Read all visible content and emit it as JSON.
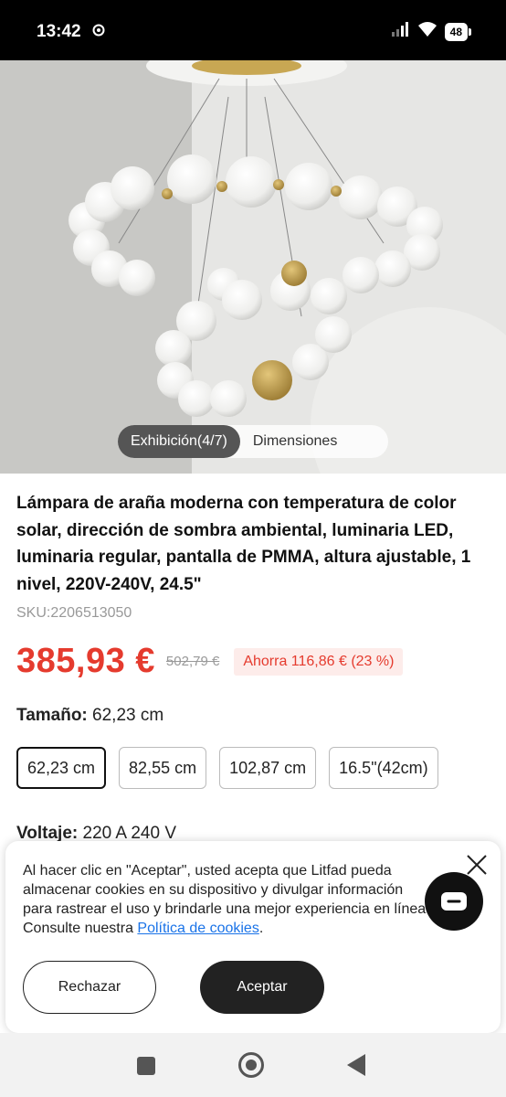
{
  "status_bar": {
    "time": "13:42",
    "battery": "48",
    "icons": [
      "settings-icon",
      "signal-icon",
      "wifi-icon",
      "battery-icon"
    ]
  },
  "media_tabs": {
    "exhibition": "Exhibición(4/7)",
    "dimensions": "Dimensiones"
  },
  "product": {
    "title": "Lámpara de araña moderna con temperatura de color solar, dirección de sombra ambiental, luminaria LED, luminaria regular, pantalla de PMMA, altura ajustable, 1 nivel, 220V-240V, 24.5\"",
    "sku": "SKU:2206513050",
    "price": "385,93 €",
    "old_price": "502,79 €",
    "savings": "Ahorra 116,86 € (23 %)",
    "price_color": "#e53b2e"
  },
  "size": {
    "label": "Tamaño:",
    "value": "62,23 cm",
    "options": [
      "62,23 cm",
      "82,55 cm",
      "102,87 cm",
      "16.5\"(42cm)"
    ],
    "selected_index": 0
  },
  "voltage": {
    "label": "Voltaje:",
    "value": "220 A 240 V"
  },
  "cookie": {
    "text": "Al hacer clic en \"Aceptar\", usted acepta que Litfad pueda almacenar cookies en su dispositivo y divulgar información para rastrear el uso y brindarle una mejor experiencia en línea. Consulte nuestra ",
    "link": "Política de cookies",
    "suffix": ".",
    "reject": "Rechazar",
    "accept": "Aceptar"
  }
}
